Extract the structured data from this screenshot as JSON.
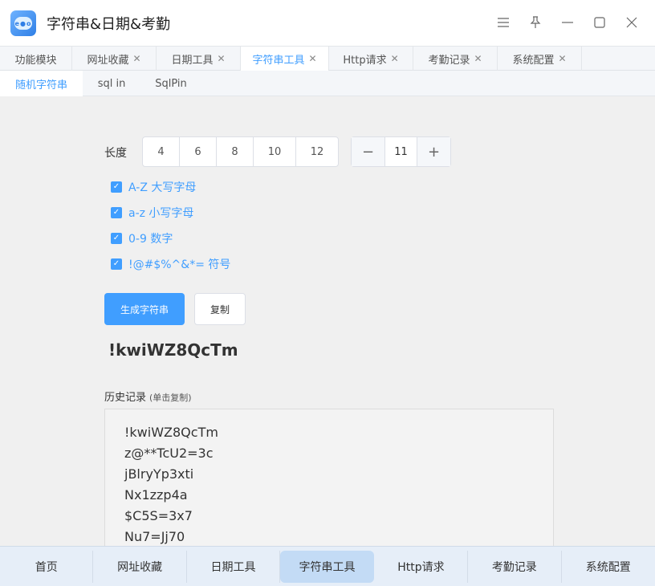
{
  "window": {
    "title": "字符串&日期&考勤",
    "icon": "app-logo-icon"
  },
  "tabs": [
    {
      "label": "功能模块",
      "closable": false,
      "active": false
    },
    {
      "label": "网址收藏",
      "closable": true,
      "active": false
    },
    {
      "label": "日期工具",
      "closable": true,
      "active": false
    },
    {
      "label": "字符串工具",
      "closable": true,
      "active": true
    },
    {
      "label": "Http请求",
      "closable": true,
      "active": false
    },
    {
      "label": "考勤记录",
      "closable": true,
      "active": false
    },
    {
      "label": "系统配置",
      "closable": true,
      "active": false
    }
  ],
  "subtabs": [
    {
      "label": "随机字符串",
      "active": true
    },
    {
      "label": "sql in",
      "active": false
    },
    {
      "label": "SqlPin",
      "active": false
    }
  ],
  "length": {
    "label": "长度",
    "presets": [
      "4",
      "6",
      "8",
      "10",
      "12"
    ],
    "value": "11",
    "minus": "−",
    "plus": "+"
  },
  "options": [
    {
      "label": "A-Z 大写字母",
      "checked": true
    },
    {
      "label": "a-z 小写字母",
      "checked": true
    },
    {
      "label": "0-9 数字",
      "checked": true
    },
    {
      "label": "!@#$%^&*= 符号",
      "checked": true
    }
  ],
  "buttons": {
    "generate": "生成字符串",
    "copy": "复制"
  },
  "result": "!kwiWZ8QcTm",
  "history": {
    "title": "历史记录",
    "hint": "(单击复制)",
    "items": [
      "!kwiWZ8QcTm",
      "z@**TcU2=3c",
      "jBlryYp3xti",
      "Nx1zzp4a",
      "$C5S=3x7",
      "Nu7=Jj70"
    ]
  },
  "bottom_nav": [
    {
      "label": "首页",
      "active": false
    },
    {
      "label": "网址收藏",
      "active": false
    },
    {
      "label": "日期工具",
      "active": false
    },
    {
      "label": "字符串工具",
      "active": true
    },
    {
      "label": "Http请求",
      "active": false
    },
    {
      "label": "考勤记录",
      "active": false
    },
    {
      "label": "系统配置",
      "active": false
    }
  ],
  "colors": {
    "accent": "#409eff",
    "bottom_active": "#c3dbf5"
  }
}
